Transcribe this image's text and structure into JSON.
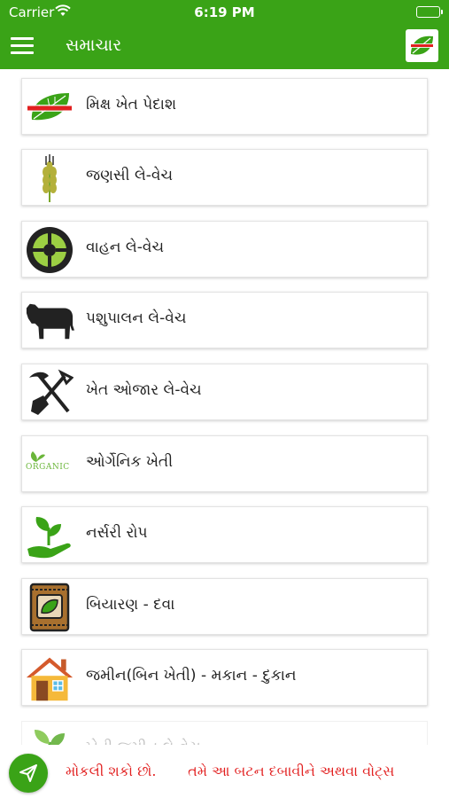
{
  "status_bar": {
    "carrier": "Carrier",
    "time": "6:19 PM",
    "battery_level": 1.0
  },
  "app_bar": {
    "title": "સમાચાર",
    "menu_icon": "hamburger-menu-icon",
    "logo_icon": "app-logo-icon"
  },
  "categories": [
    {
      "label": "મિક્ષ ખેત પેદાશ",
      "icon": "leaf-logo-icon"
    },
    {
      "label": "જણસી લે-વેચ",
      "icon": "wheat-icon"
    },
    {
      "label": "વાહન લે-વેચ",
      "icon": "tyre-icon"
    },
    {
      "label": "પશુપાલન લે-વેચ",
      "icon": "cow-icon"
    },
    {
      "label": "ખેત ઓજાર લે-વેચ",
      "icon": "tools-icon"
    },
    {
      "label": "ઓર્ગેનિક ખેતી",
      "icon": "organic-icon",
      "icon_text": "ORGANIC"
    },
    {
      "label": "નર્સરી રોપ",
      "icon": "plant-hand-icon"
    },
    {
      "label": "બિયારણ - દવા",
      "icon": "seed-bag-icon"
    },
    {
      "label": "જમીન(બિન ખેતી) - મકાન - દુકાન",
      "icon": "house-icon"
    },
    {
      "label": "ખેતી જમીન લે-વેચ",
      "icon": "sprout-icon"
    }
  ],
  "ticker": {
    "text": "મોકલી શકો છો.       તમે આ બટન દબાવીને અથવા વોટ્સ"
  },
  "fab_icon": "send-icon",
  "colors": {
    "primary": "#3aa317",
    "ticker": "#e22020"
  }
}
